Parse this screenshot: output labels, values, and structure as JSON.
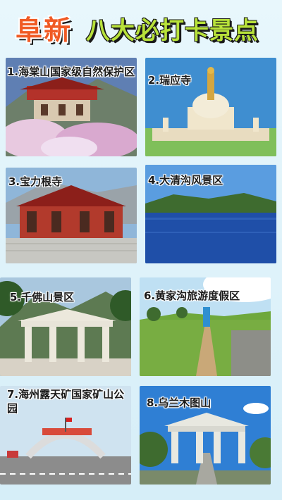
{
  "title": {
    "city": "阜新",
    "main": "八大必打卡景点"
  },
  "spots": [
    {
      "label": "1.海棠山国家级自然保护区"
    },
    {
      "label": "2.瑞应寺"
    },
    {
      "label": "3.宝力根寺"
    },
    {
      "label": "4.大清沟风景区"
    },
    {
      "label": "5.千佛山景区"
    },
    {
      "label": "6.黄家沟旅游度假区"
    },
    {
      "label": "7.海州露天矿国家矿山公园"
    },
    {
      "label": "8.乌兰木图山"
    }
  ]
}
